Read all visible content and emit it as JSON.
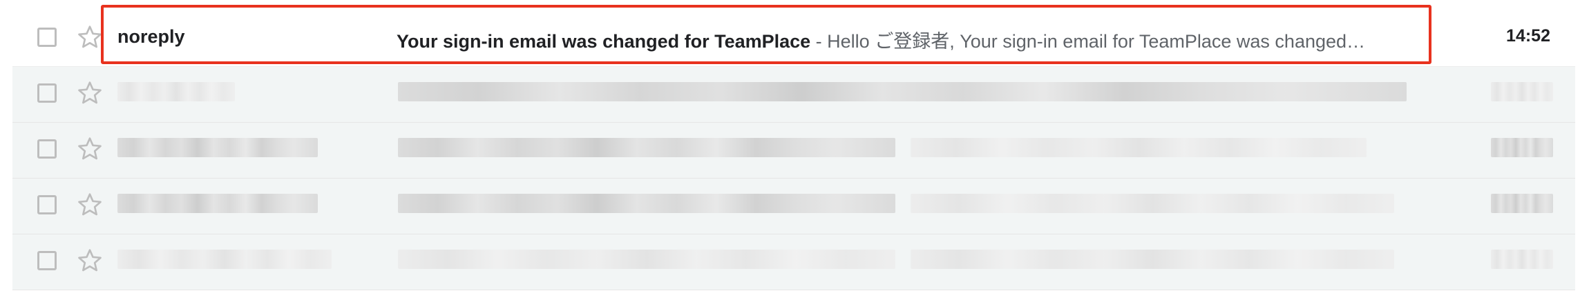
{
  "emails": [
    {
      "sender": "noreply",
      "subject": "Your sign-in email was changed for TeamPlace",
      "separator": " - ",
      "snippet": "Hello ご登録者, Your sign-in email for TeamPlace was changed…",
      "time": "14:52",
      "unread": true,
      "highlighted": true
    }
  ],
  "redacted_rows": 4,
  "colors": {
    "highlight_border": "#e8321e",
    "row_read_bg": "#f2f5f5",
    "text_primary": "#202124",
    "text_secondary": "#5f6368",
    "checkbox_border": "#bdbdbd",
    "star_outline": "#bdbdbd"
  },
  "icons": {
    "checkbox": "checkbox-icon",
    "star": "star-outline-icon"
  }
}
